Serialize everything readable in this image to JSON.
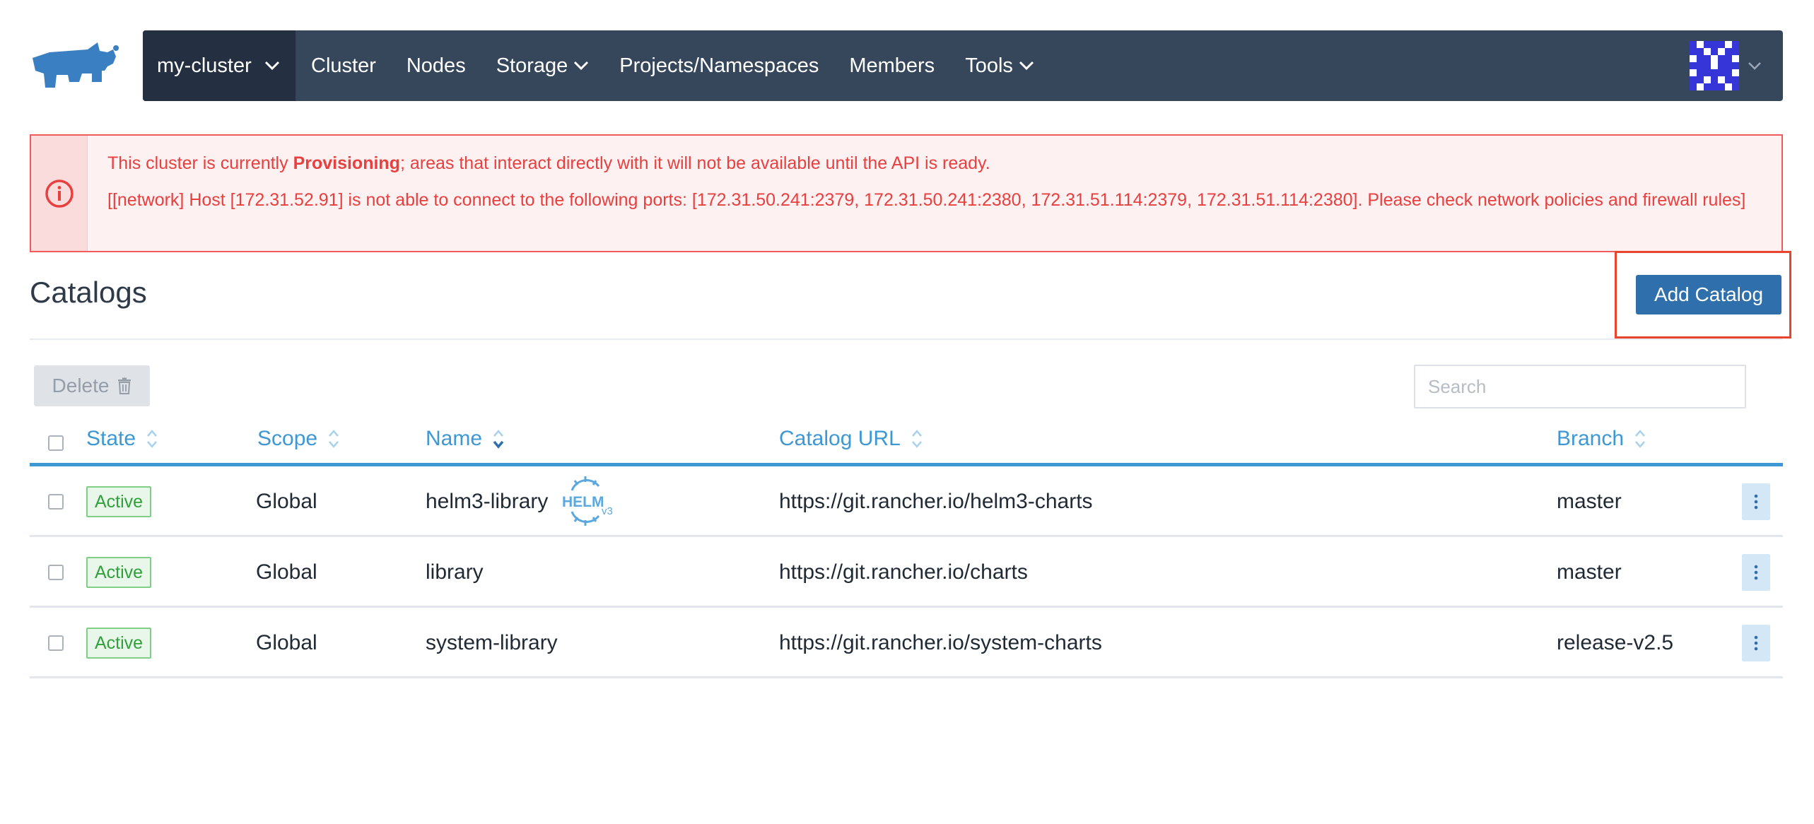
{
  "header": {
    "logo_icon": "rancher-logo-icon",
    "cluster_name": "my-cluster",
    "nav_items": [
      {
        "label": "Cluster",
        "dropdown": false
      },
      {
        "label": "Nodes",
        "dropdown": false
      },
      {
        "label": "Storage",
        "dropdown": true
      },
      {
        "label": "Projects/Namespaces",
        "dropdown": false
      },
      {
        "label": "Members",
        "dropdown": false
      },
      {
        "label": "Tools",
        "dropdown": true
      }
    ],
    "avatar_icon": "user-avatar-icon"
  },
  "alert": {
    "icon": "info-circle-icon",
    "line1_prefix": "This cluster is currently ",
    "line1_state": "Provisioning",
    "line1_suffix": "; areas that interact directly with it will not be available until the API is ready.",
    "line2": "[[network] Host [172.31.52.91] is not able to connect to the following ports: [172.31.50.241:2379, 172.31.50.241:2380, 172.31.51.114:2379, 172.31.51.114:2380]. Please check network policies and firewall rules]"
  },
  "page": {
    "title": "Catalogs",
    "add_button": "Add Catalog"
  },
  "toolbar": {
    "delete_label": "Delete",
    "search_placeholder": "Search"
  },
  "table": {
    "columns": [
      "State",
      "Scope",
      "Name",
      "Catalog URL",
      "Branch"
    ],
    "sorted_column": "Name",
    "rows": [
      {
        "state": "Active",
        "scope": "Global",
        "name": "helm3-library",
        "helm_badge": "HELM",
        "helm_version": "v3",
        "url": "https://git.rancher.io/helm3-charts",
        "branch": "master"
      },
      {
        "state": "Active",
        "scope": "Global",
        "name": "library",
        "url": "https://git.rancher.io/charts",
        "branch": "master"
      },
      {
        "state": "Active",
        "scope": "Global",
        "name": "system-library",
        "url": "https://git.rancher.io/system-charts",
        "branch": "release-v2.5"
      }
    ]
  },
  "colors": {
    "navbar": "#37475b",
    "navbar_active": "#243041",
    "alert_text": "#e83f3f",
    "primary_button": "#2f6fac",
    "table_header": "#3d98d3",
    "active_badge": "#30a03c",
    "highlight_frame": "#e8452c"
  }
}
